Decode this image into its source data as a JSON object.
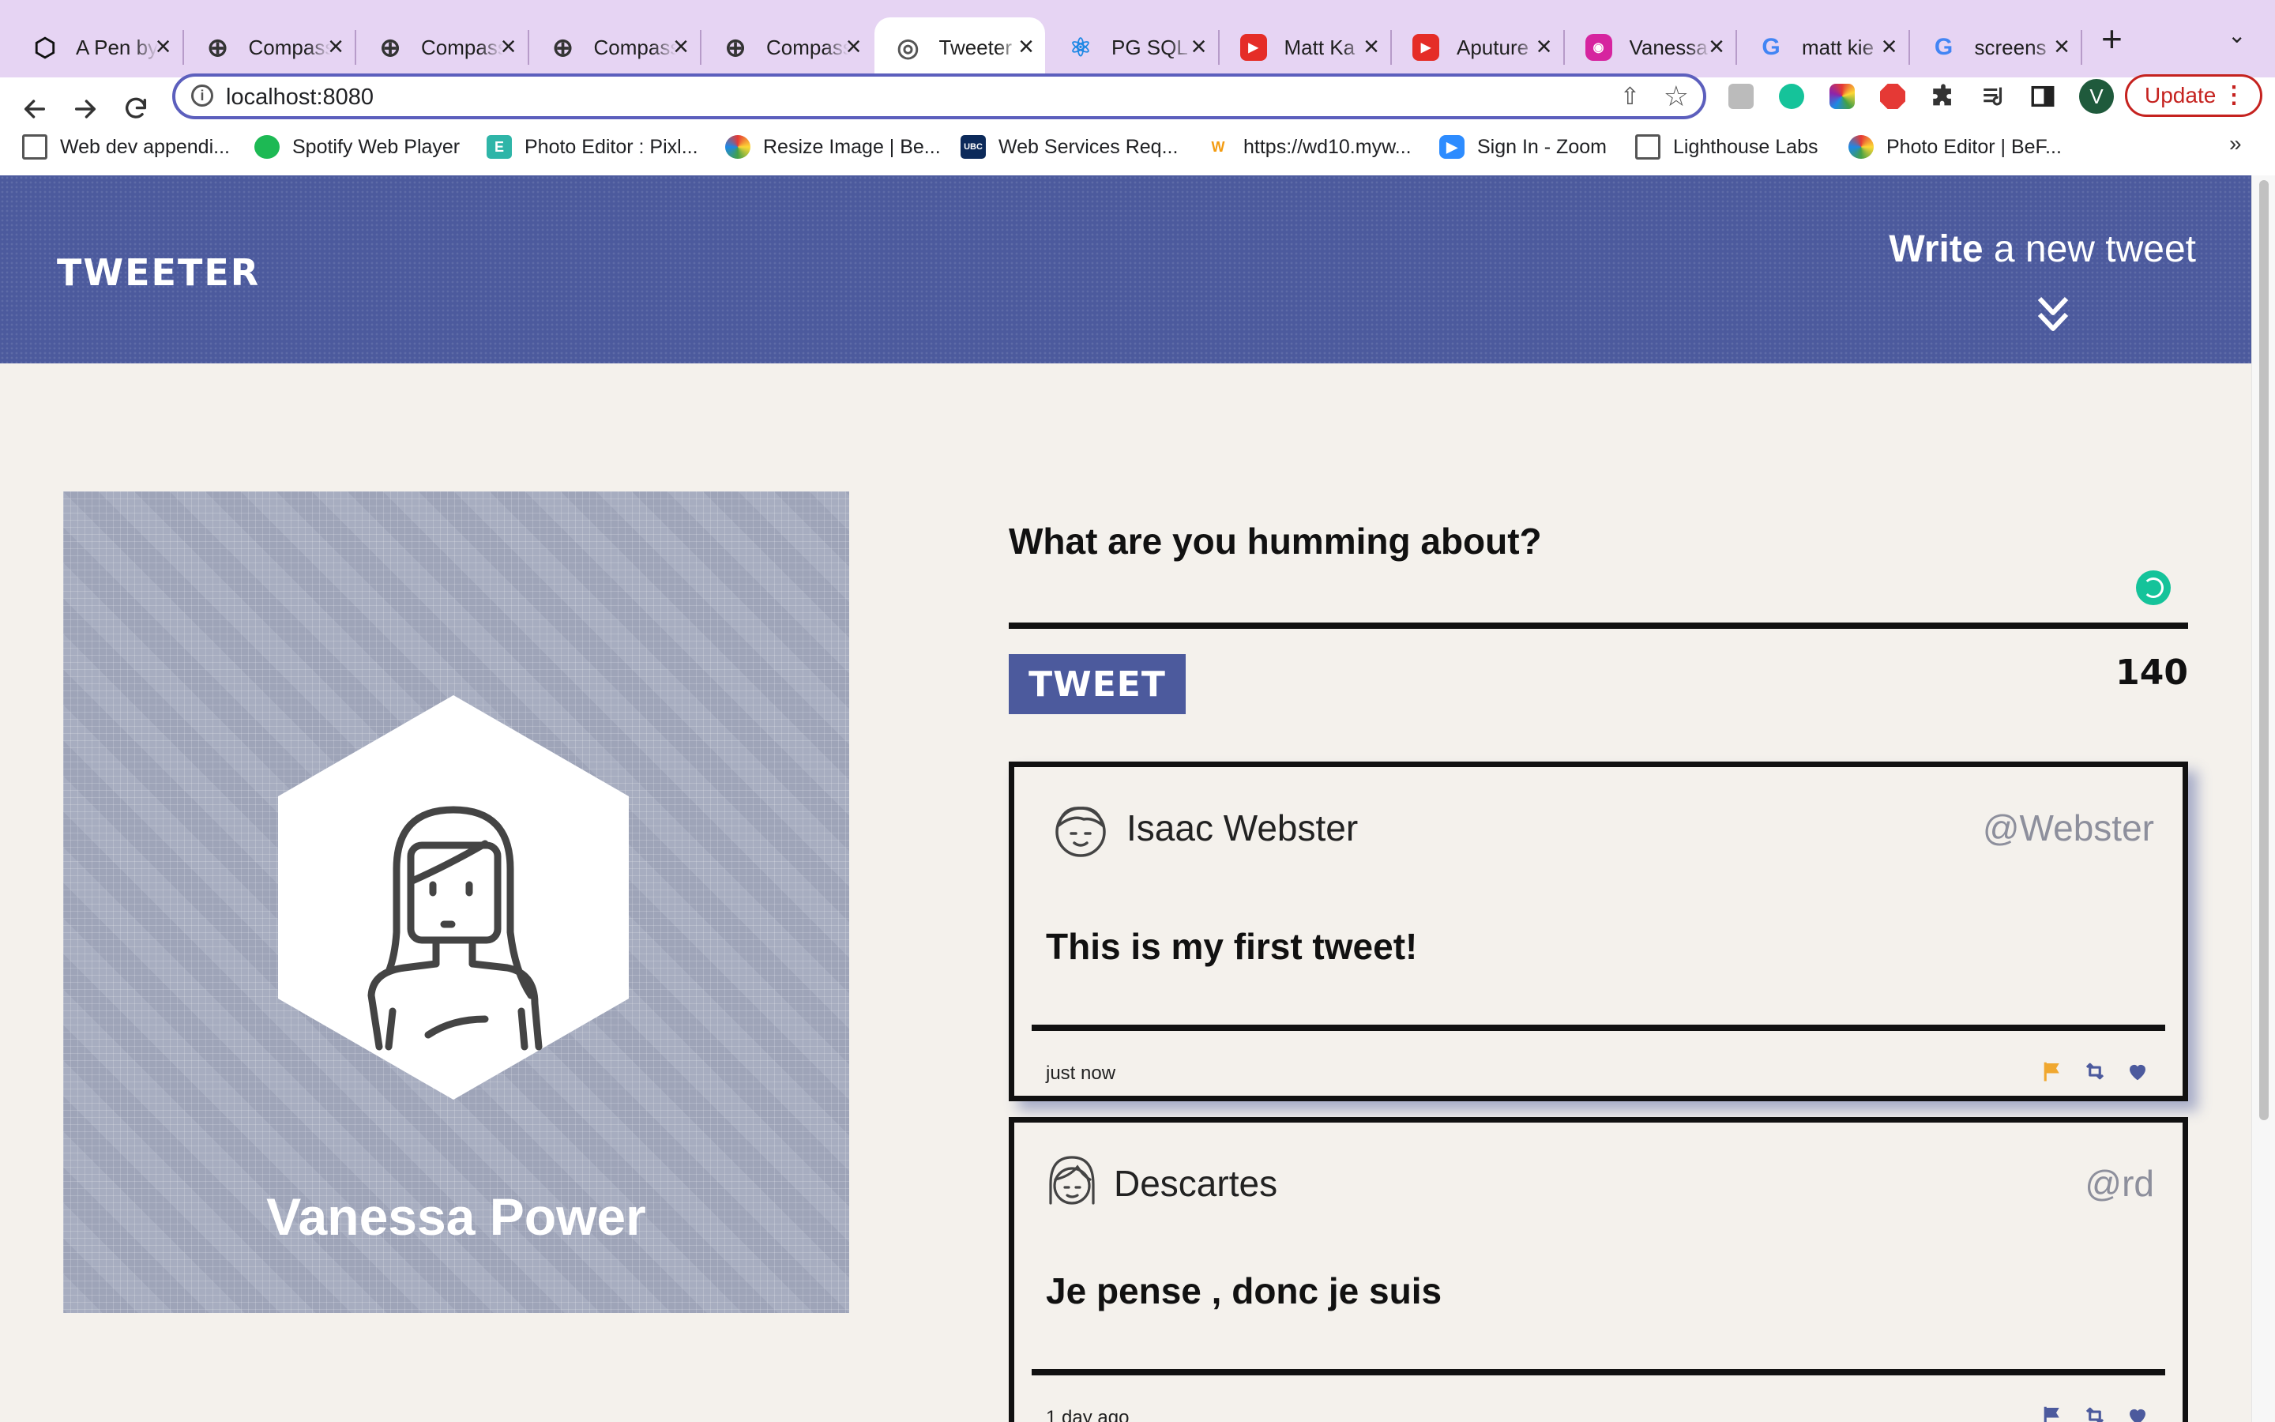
{
  "browser": {
    "tabs": [
      {
        "title": "A Pen by",
        "icon": "codepen-icon",
        "color": "#111111"
      },
      {
        "title": "Compass",
        "icon": "compass-icon",
        "color": "#333333"
      },
      {
        "title": "Compass",
        "icon": "compass-icon",
        "color": "#333333"
      },
      {
        "title": "Compass",
        "icon": "compass-icon",
        "color": "#333333"
      },
      {
        "title": "Compass",
        "icon": "compass-icon",
        "color": "#333333"
      },
      {
        "title": "Tweeter",
        "icon": "globe-icon",
        "color": "#555555",
        "active": true
      },
      {
        "title": "PG SQL",
        "icon": "react-icon",
        "color": "#1e88e5"
      },
      {
        "title": "Matt Ka",
        "icon": "youtube-icon",
        "color": "#e52d27"
      },
      {
        "title": "Aputure",
        "icon": "youtube-icon",
        "color": "#e52d27"
      },
      {
        "title": "Vanessa",
        "icon": "instagram-icon",
        "color": "#d6249f"
      },
      {
        "title": "matt kie",
        "icon": "google-icon",
        "color": "#4285f4"
      },
      {
        "title": "screens",
        "icon": "google-icon",
        "color": "#4285f4"
      }
    ],
    "url": "localhost:8080",
    "avatar_initial": "V",
    "update_label": "Update",
    "bookmarks": [
      {
        "label": "Web dev appendi...",
        "icon": "folder-icon"
      },
      {
        "label": "Spotify Web Player",
        "icon": "spotify-icon"
      },
      {
        "label": "Photo Editor : Pixl...",
        "icon": "pixlr-icon"
      },
      {
        "label": "Resize Image | Be...",
        "icon": "befunky-icon"
      },
      {
        "label": "Web Services Req...",
        "icon": "ubc-icon"
      },
      {
        "label": "https://wd10.myw...",
        "icon": "workday-icon"
      },
      {
        "label": "Sign In - Zoom",
        "icon": "zoom-icon"
      },
      {
        "label": "Lighthouse Labs",
        "icon": "folder-icon"
      },
      {
        "label": "Photo Editor | BeF...",
        "icon": "befunky-icon"
      }
    ]
  },
  "header": {
    "brand": "TWEETER",
    "compose_bold": "Write",
    "compose_rest": " a new tweet"
  },
  "profile": {
    "name": "Vanessa Power"
  },
  "composer": {
    "prompt": "What are you humming about?",
    "button_label": "TWEET",
    "counter": "140"
  },
  "tweets": [
    {
      "name": "Isaac Webster",
      "handle": "@Webster",
      "content": "This is my first tweet!",
      "time": "just now",
      "flag_color": "#f0a830"
    },
    {
      "name": "Descartes",
      "handle": "@rd",
      "content": "Je pense , donc je suis",
      "time": "1 day ago",
      "flag_color": "#4c5a9d"
    }
  ],
  "colors": {
    "accent": "#4c5a9d",
    "page_bg": "#f4f1ec",
    "chrome_tabbar": "#e6d4f3"
  }
}
